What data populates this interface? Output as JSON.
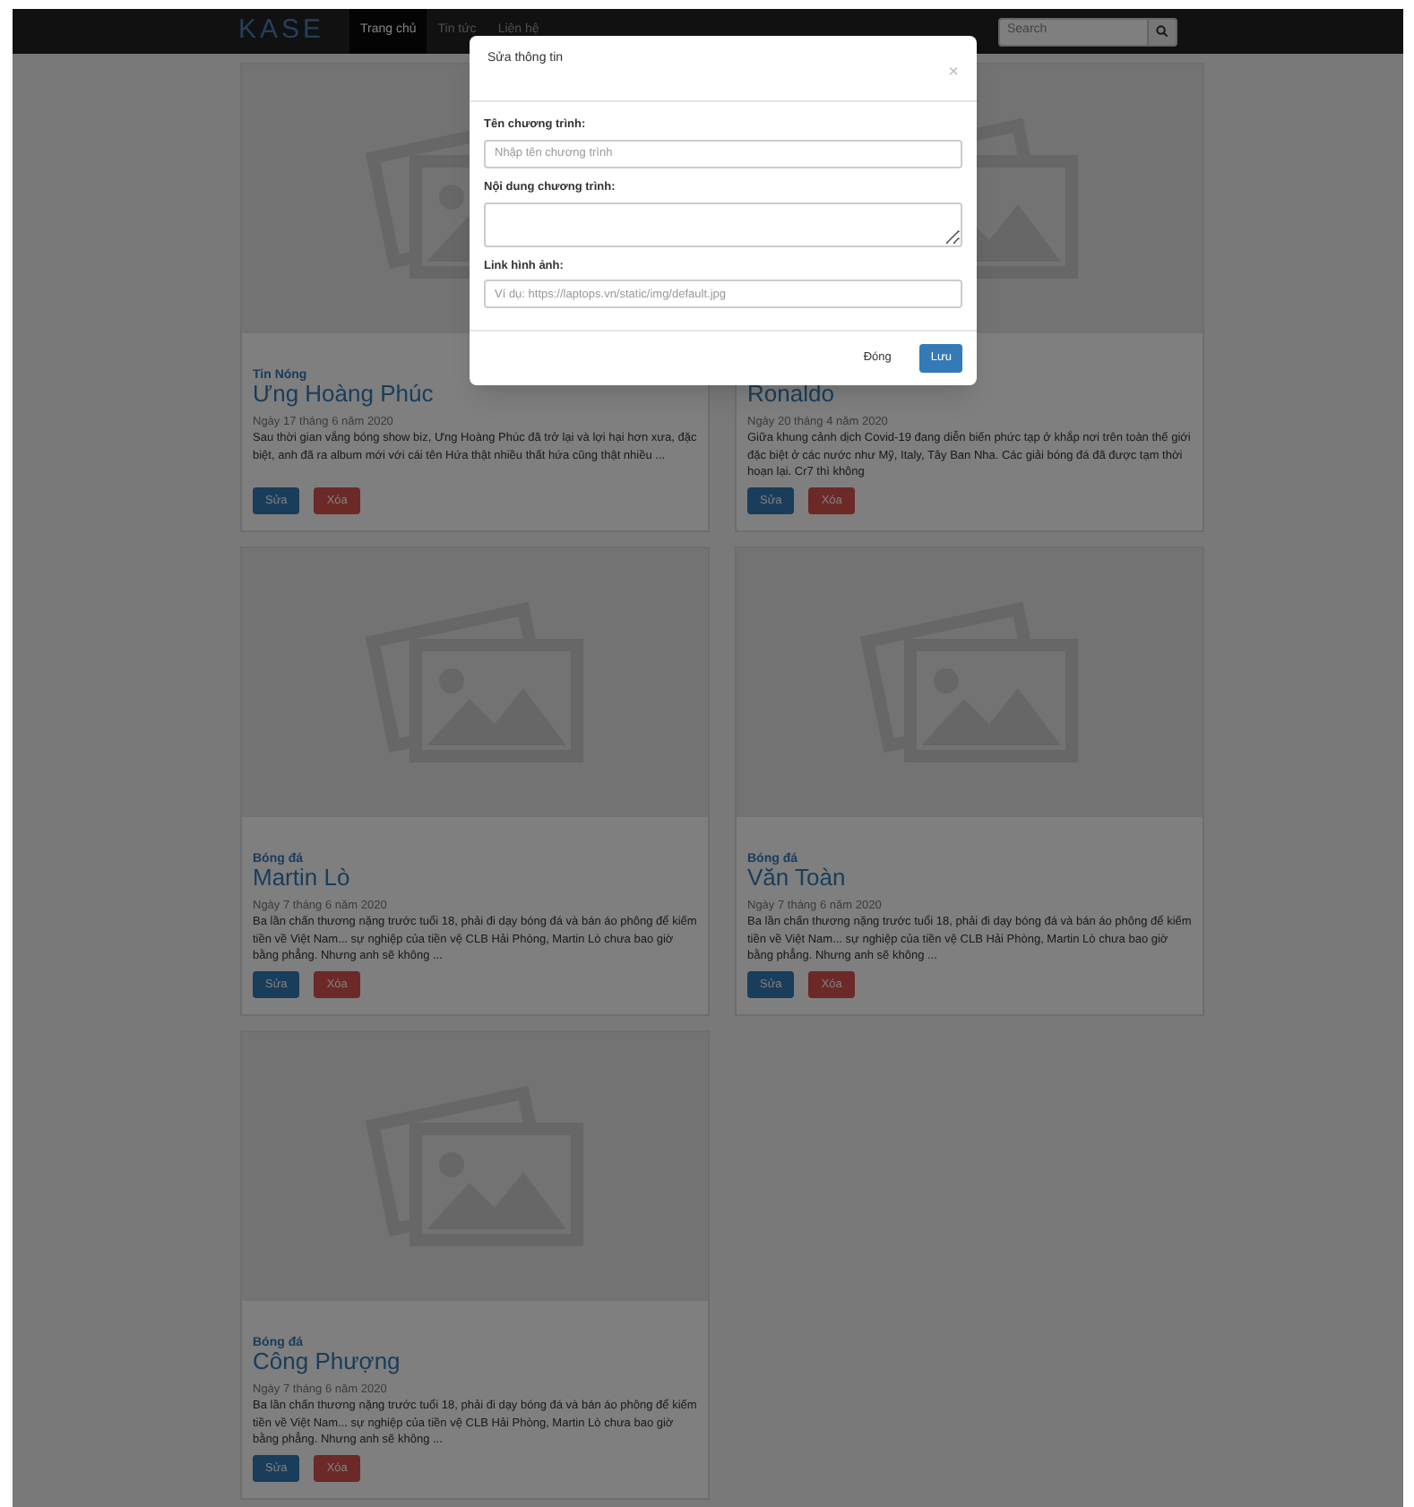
{
  "navbar": {
    "logo": "KASE",
    "links": [
      {
        "label": "Trang chủ",
        "selected": true
      },
      {
        "label": "Tin tức",
        "selected": false
      },
      {
        "label": "Liên hệ",
        "selected": false
      }
    ],
    "search": {
      "placeholder": "Search"
    }
  },
  "cards": [
    {
      "category": "Tin Nóng",
      "title": "Ưng Hoàng Phúc",
      "date": "Ngày 17 tháng 6 năm 2020",
      "text": "Sau thời gian vắng bóng show biz, Ưng Hoàng Phúc đã trở lại và lợi hại hơn xưa, đặc biệt, anh đã ra album mới với cái tên Hứa thật nhiều thất hứa cũng thật nhiều ...",
      "buttons": [
        {
          "label": "Sửa",
          "kind": "edit"
        },
        {
          "label": "Xóa",
          "kind": "delete"
        }
      ]
    },
    {
      "title": "Ronaldo",
      "date": "Ngày 20 tháng 4 năm 2020",
      "text": "Giữa khung cảnh dịch Covid-19 đang diễn biến phức tạp ở khắp nơi trên toàn thế giới đặc biệt ở các nước như Mỹ, Italy, Tây Ban Nha. Các giải bóng đá đã được tạm thời hoạn lại. Cr7 thì không",
      "buttons": [
        {
          "label": "Sửa",
          "kind": "edit"
        },
        {
          "label": "Xóa",
          "kind": "delete"
        }
      ]
    },
    {
      "category": "Bóng đá",
      "title": "Martin Lò",
      "date": "Ngày 7 tháng 6 năm 2020",
      "text": "Ba lần chấn thương nặng trước tuổi 18, phải đi dạy bóng đá và bán áo phông để kiếm tiền về Việt Nam... sự nghiệp của tiền vệ CLB Hải Phòng, Martin Lò chưa bao giờ bằng phẳng. Nhưng anh sẽ không ...",
      "buttons": [
        {
          "label": "Sửa",
          "kind": "edit"
        },
        {
          "label": "Xóa",
          "kind": "delete"
        }
      ]
    },
    {
      "category": "Bóng đá",
      "title": "Văn Toàn",
      "date": "Ngày 7 tháng 6 năm 2020",
      "text": "Ba lần chấn thương nặng trước tuổi 18, phải đi dạy bóng đá và bán áo phông để kiếm tiền về Việt Nam... sự nghiệp của tiền vệ CLB Hải Phòng, Martin Lò chưa bao giờ bằng phẳng. Nhưng anh sẽ không ...",
      "buttons": [
        {
          "label": "Sửa",
          "kind": "edit"
        },
        {
          "label": "Xóa",
          "kind": "delete"
        }
      ]
    },
    {
      "category": "Bóng đá",
      "title": "Công Phượng",
      "date": "Ngày 7 tháng 6 năm 2020",
      "text": "Ba lần chấn thương nặng trước tuổi 18, phải đi dạy bóng đá và bán áo phông để kiếm tiền về Việt Nam... sự nghiệp của tiền vệ CLB Hải Phòng, Martin Lò chưa bao giờ bằng phẳng. Nhưng anh sẽ không ...",
      "buttons": [
        {
          "label": "Sửa",
          "kind": "edit"
        },
        {
          "label": "Xóa",
          "kind": "delete"
        }
      ]
    }
  ],
  "modal": {
    "title": "Sửa thông tin",
    "close": "×",
    "fields": [
      {
        "label": "Tên chương trình:",
        "placeholder": "Nhập tên chương trình",
        "kind": "input"
      },
      {
        "label": "Nội dung chương trình:",
        "kind": "textarea"
      },
      {
        "label": "Link hình ảnh:",
        "placeholder": "Ví dụ: https://laptops.vn/static/img/default.jpg",
        "kind": "input"
      }
    ],
    "buttons": [
      {
        "label": "Đóng",
        "kind": "secondary"
      },
      {
        "label": "Lưu",
        "kind": "primary"
      }
    ]
  }
}
